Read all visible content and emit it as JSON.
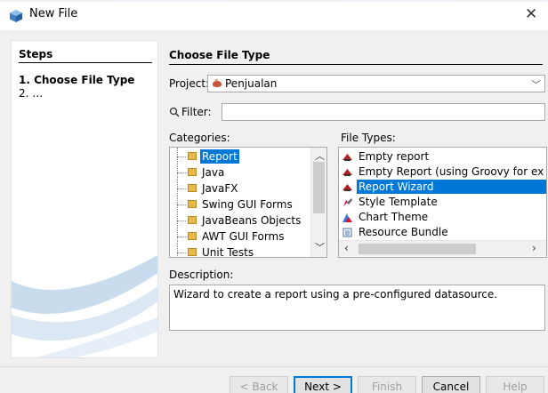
{
  "window": {
    "title": "New File",
    "close_glyph": "✕"
  },
  "steps": {
    "header": "Steps",
    "items": [
      "1.  Choose File Type",
      "2.  …"
    ]
  },
  "main": {
    "header": "Choose File Type",
    "project_label": "Project:",
    "project_value": "Penjualan",
    "filter_label": "Filter:",
    "filter_value": "",
    "categories_label": "Categories:",
    "categories": [
      "Report",
      "Java",
      "JavaFX",
      "Swing GUI Forms",
      "JavaBeans Objects",
      "AWT GUI Forms",
      "Unit Tests"
    ],
    "selected_category": "Report",
    "file_types_label": "File Types:",
    "file_types": [
      {
        "label": "Empty report",
        "icon": "report-icon"
      },
      {
        "label": "Empty Report (using Groovy for ex",
        "icon": "report-icon"
      },
      {
        "label": "Report Wizard",
        "icon": "report-icon"
      },
      {
        "label": "Style Template",
        "icon": "style-icon"
      },
      {
        "label": "Chart Theme",
        "icon": "chart-icon"
      },
      {
        "label": "Resource Bundle",
        "icon": "bundle-icon"
      }
    ],
    "selected_file_type": "Report Wizard",
    "description_label": "Description:",
    "description": "Wizard to create a report using a pre-configured datasource."
  },
  "buttons": {
    "back": "< Back",
    "next": "Next >",
    "finish": "Finish",
    "cancel": "Cancel",
    "help": "Help"
  },
  "colors": {
    "selection": "#0078d7",
    "folder": "#e8b84a",
    "report": "#b22222"
  }
}
